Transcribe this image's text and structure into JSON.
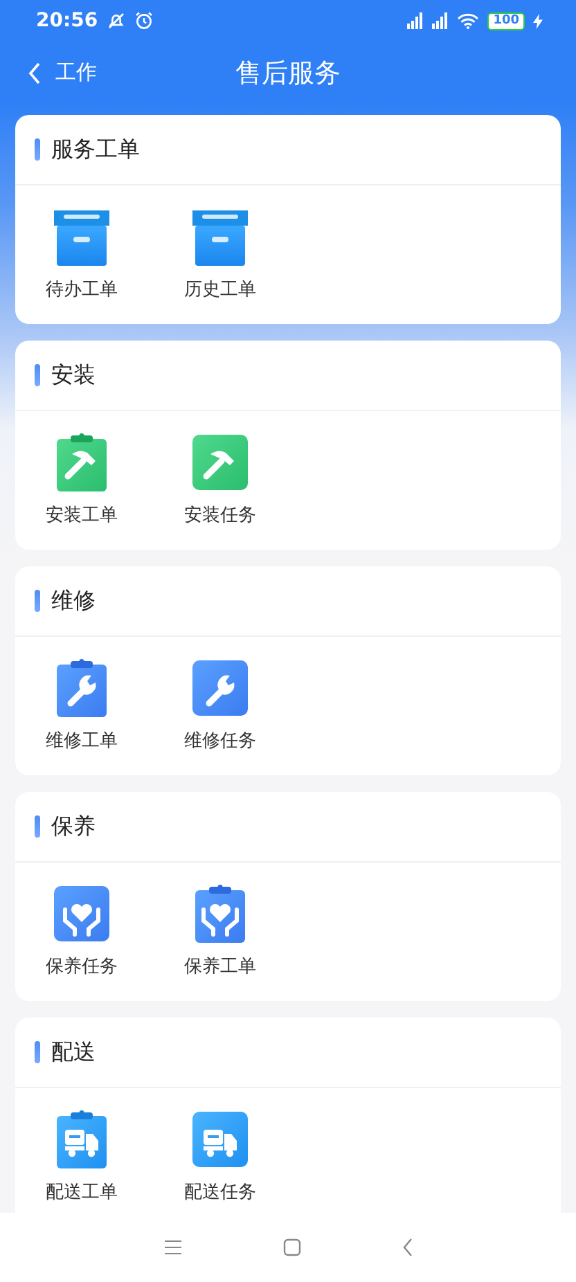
{
  "status_bar": {
    "time": "20:56",
    "battery": "100"
  },
  "header": {
    "back_label": "工作",
    "title": "售后服务"
  },
  "sections": [
    {
      "title": "服务工单",
      "items": [
        {
          "label": "待办工单",
          "kind": "box"
        },
        {
          "label": "历史工单",
          "kind": "box"
        }
      ]
    },
    {
      "title": "安装",
      "items": [
        {
          "label": "安装工单",
          "kind": "hammer-clip"
        },
        {
          "label": "安装任务",
          "kind": "hammer"
        }
      ]
    },
    {
      "title": "维修",
      "items": [
        {
          "label": "维修工单",
          "kind": "wrench-clip"
        },
        {
          "label": "维修任务",
          "kind": "wrench"
        }
      ]
    },
    {
      "title": "保养",
      "items": [
        {
          "label": "保养任务",
          "kind": "hands"
        },
        {
          "label": "保养工单",
          "kind": "hands-clip"
        }
      ]
    },
    {
      "title": "配送",
      "items": [
        {
          "label": "配送工单",
          "kind": "truck-clip"
        },
        {
          "label": "配送任务",
          "kind": "truck"
        }
      ]
    }
  ]
}
